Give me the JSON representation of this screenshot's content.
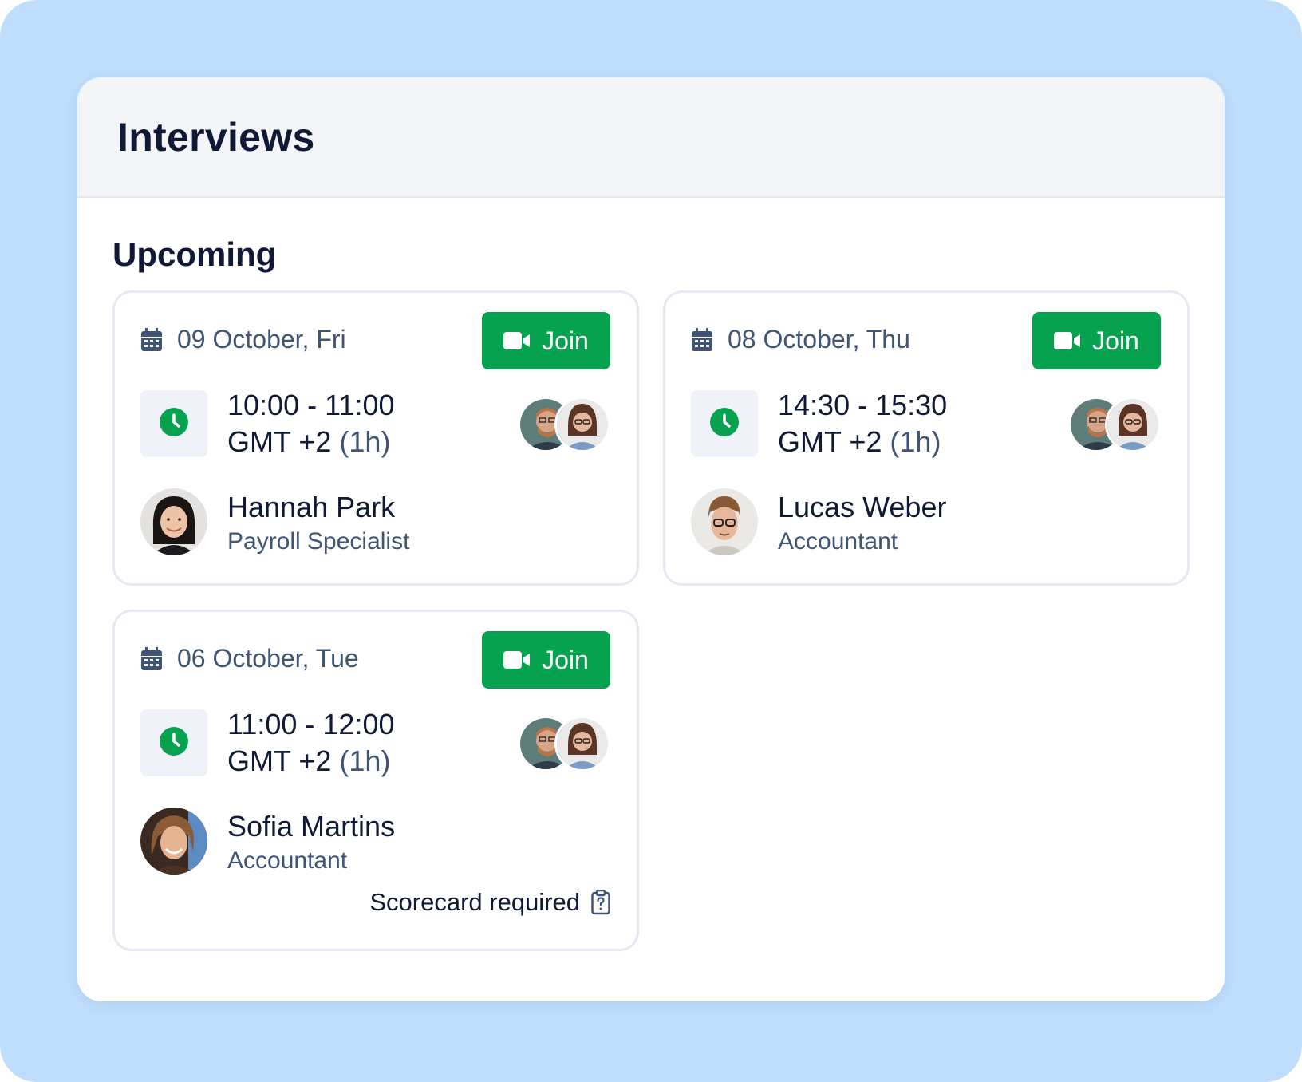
{
  "panel": {
    "title": "Interviews"
  },
  "section": {
    "title": "Upcoming"
  },
  "join_label": "Join",
  "colors": {
    "accent": "#07a24f",
    "background": "#bfdefc",
    "text_primary": "#101a35",
    "text_secondary": "#3f5573"
  },
  "interviews": [
    {
      "date": "09 October, Fri",
      "time": "10:00 - 11:00",
      "timezone": "GMT +2",
      "duration": "(1h)",
      "candidate_name": "Hannah Park",
      "candidate_role": "Payroll Specialist"
    },
    {
      "date": "08 October, Thu",
      "time": "14:30 - 15:30",
      "timezone": "GMT +2",
      "duration": "(1h)",
      "candidate_name": "Lucas Weber",
      "candidate_role": "Accountant"
    },
    {
      "date": "06 October, Tue",
      "time": "11:00 - 12:00",
      "timezone": "GMT +2",
      "duration": "(1h)",
      "candidate_name": "Sofia Martins",
      "candidate_role": "Accountant",
      "note": "Scorecard required"
    }
  ],
  "icons": {
    "date": "calendar-icon",
    "join": "video-camera-icon",
    "time": "clock-icon",
    "note": "clipboard-question-icon"
  }
}
